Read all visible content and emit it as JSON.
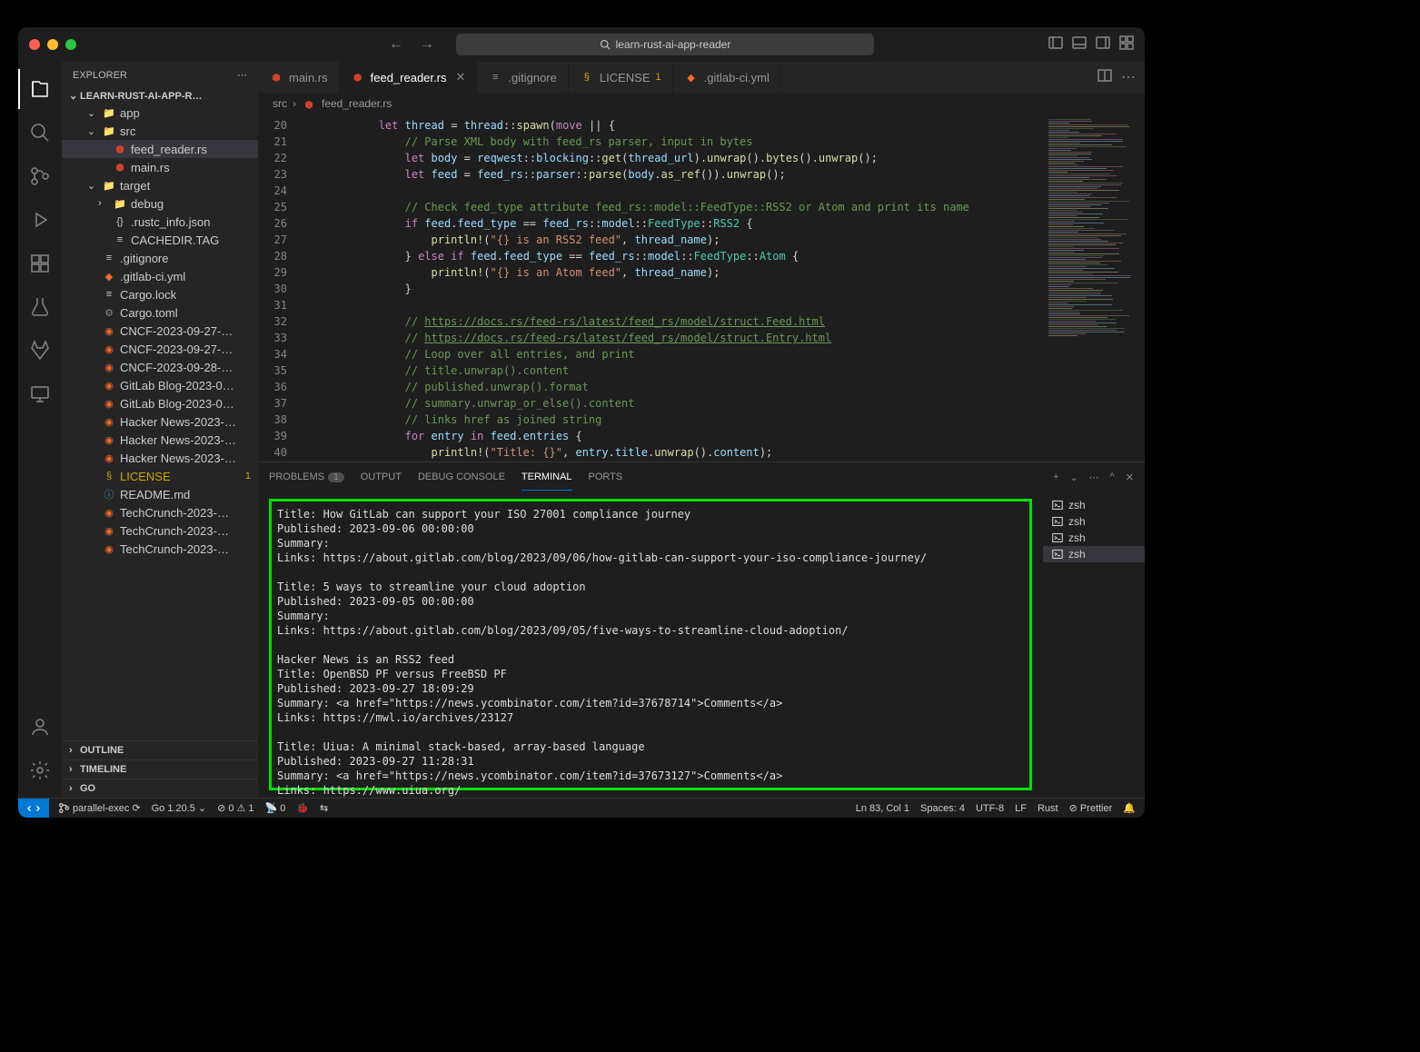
{
  "titlebar": {
    "search": "learn-rust-ai-app-reader"
  },
  "sidebar": {
    "title": "EXPLORER",
    "project": "LEARN-RUST-AI-APP-R…",
    "tree": [
      {
        "label": "app",
        "kind": "folder",
        "depth": 1,
        "open": true
      },
      {
        "label": "src",
        "kind": "folder",
        "depth": 1,
        "open": true
      },
      {
        "label": "feed_reader.rs",
        "kind": "rust",
        "depth": 2,
        "sel": true
      },
      {
        "label": "main.rs",
        "kind": "rust",
        "depth": 2
      },
      {
        "label": "target",
        "kind": "folder",
        "depth": 1,
        "open": true
      },
      {
        "label": "debug",
        "kind": "folder",
        "depth": 2,
        "open": false
      },
      {
        "label": ".rustc_info.json",
        "kind": "json",
        "depth": 2
      },
      {
        "label": "CACHEDIR.TAG",
        "kind": "file",
        "depth": 2
      },
      {
        "label": ".gitignore",
        "kind": "file",
        "depth": 1
      },
      {
        "label": ".gitlab-ci.yml",
        "kind": "gitlab",
        "depth": 1
      },
      {
        "label": "Cargo.lock",
        "kind": "file",
        "depth": 1
      },
      {
        "label": "Cargo.toml",
        "kind": "toml",
        "depth": 1
      },
      {
        "label": "CNCF-2023-09-27-…",
        "kind": "rss",
        "depth": 1
      },
      {
        "label": "CNCF-2023-09-27-…",
        "kind": "rss",
        "depth": 1
      },
      {
        "label": "CNCF-2023-09-28-…",
        "kind": "rss",
        "depth": 1
      },
      {
        "label": "GitLab Blog-2023-0…",
        "kind": "rss",
        "depth": 1
      },
      {
        "label": "GitLab Blog-2023-0…",
        "kind": "rss",
        "depth": 1
      },
      {
        "label": "Hacker News-2023-…",
        "kind": "rss",
        "depth": 1
      },
      {
        "label": "Hacker News-2023-…",
        "kind": "rss",
        "depth": 1
      },
      {
        "label": "Hacker News-2023-…",
        "kind": "rss",
        "depth": 1
      },
      {
        "label": "LICENSE",
        "kind": "license",
        "depth": 1,
        "warn": true,
        "badge": "1"
      },
      {
        "label": "README.md",
        "kind": "md",
        "depth": 1
      },
      {
        "label": "TechCrunch-2023-…",
        "kind": "rss",
        "depth": 1
      },
      {
        "label": "TechCrunch-2023-…",
        "kind": "rss",
        "depth": 1
      },
      {
        "label": "TechCrunch-2023-…",
        "kind": "rss",
        "depth": 1
      }
    ],
    "outline": "OUTLINE",
    "timeline": "TIMELINE",
    "go": "GO"
  },
  "tabs": [
    {
      "label": "main.rs",
      "icon": "rust"
    },
    {
      "label": "feed_reader.rs",
      "icon": "rust",
      "active": true
    },
    {
      "label": ".gitignore",
      "icon": "file"
    },
    {
      "label": "LICENSE",
      "icon": "license",
      "badge": "1"
    },
    {
      "label": ".gitlab-ci.yml",
      "icon": "gitlab"
    }
  ],
  "breadcrumbs": [
    "src",
    "feed_reader.rs"
  ],
  "editor": {
    "lines_start": 20,
    "lines_end": 40,
    "rows": [
      "            <span class='kw'>let</span> <span class='var'>thread</span> <span class='op'>=</span> <span class='var'>thread</span><span class='pun'>::</span><span class='fn'>spawn</span><span class='pun'>(</span><span class='kw'>move</span> <span class='pun'>||</span> <span class='pun'>{</span>",
      "                <span class='cmt'>// Parse XML body with feed_rs parser, input in bytes</span>",
      "                <span class='kw'>let</span> <span class='var'>body</span> <span class='op'>=</span> <span class='var'>reqwest</span><span class='pun'>::</span><span class='var'>blocking</span><span class='pun'>::</span><span class='fn'>get</span><span class='pun'>(</span><span class='var'>thread_url</span><span class='pun'>)</span><span class='pun'>.</span><span class='fn'>unwrap</span><span class='pun'>()</span><span class='pun'>.</span><span class='fn'>bytes</span><span class='pun'>()</span><span class='pun'>.</span><span class='fn'>unwrap</span><span class='pun'>();</span>",
      "                <span class='kw'>let</span> <span class='var'>feed</span> <span class='op'>=</span> <span class='var'>feed_rs</span><span class='pun'>::</span><span class='var'>parser</span><span class='pun'>::</span><span class='fn'>parse</span><span class='pun'>(</span><span class='var'>body</span><span class='pun'>.</span><span class='fn'>as_ref</span><span class='pun'>())</span><span class='pun'>.</span><span class='fn'>unwrap</span><span class='pun'>();</span>",
      "",
      "                <span class='cmt'>// Check feed_type attribute feed_rs::model::FeedType::RSS2 or Atom and print its name</span>",
      "                <span class='kw'>if</span> <span class='var'>feed</span><span class='pun'>.</span><span class='var'>feed_type</span> <span class='op'>==</span> <span class='var'>feed_rs</span><span class='pun'>::</span><span class='var'>model</span><span class='pun'>::</span><span class='typ'>FeedType</span><span class='pun'>::</span><span class='typ'>RSS2</span> <span class='pun'>{</span>",
      "                    <span class='fn'>println!</span><span class='pun'>(</span><span class='str'>\"{} is an RSS2 feed\"</span><span class='pun'>,</span> <span class='var'>thread_name</span><span class='pun'>);</span>",
      "                <span class='pun'>}</span> <span class='kw'>else if</span> <span class='var'>feed</span><span class='pun'>.</span><span class='var'>feed_type</span> <span class='op'>==</span> <span class='var'>feed_rs</span><span class='pun'>::</span><span class='var'>model</span><span class='pun'>::</span><span class='typ'>FeedType</span><span class='pun'>::</span><span class='typ'>Atom</span> <span class='pun'>{</span>",
      "                    <span class='fn'>println!</span><span class='pun'>(</span><span class='str'>\"{} is an Atom feed\"</span><span class='pun'>,</span> <span class='var'>thread_name</span><span class='pun'>);</span>",
      "                <span class='pun'>}</span>",
      "",
      "                <span class='cmt'>// <span class='lnk'>https://docs.rs/feed-rs/latest/feed_rs/model/struct.Feed.html</span></span>",
      "                <span class='cmt'>// <span class='lnk'>https://docs.rs/feed-rs/latest/feed_rs/model/struct.Entry.html</span></span>",
      "                <span class='cmt'>// Loop over all entries, and print</span>",
      "                <span class='cmt'>// title.unwrap().content</span>",
      "                <span class='cmt'>// published.unwrap().format</span>",
      "                <span class='cmt'>// summary.unwrap_or_else().content</span>",
      "                <span class='cmt'>// links href as joined string</span>",
      "                <span class='kw'>for</span> <span class='var'>entry</span> <span class='kw'>in</span> <span class='var'>feed</span><span class='pun'>.</span><span class='var'>entries</span> <span class='pun'>{</span>",
      "                    <span class='fn'>println!</span><span class='pun'>(</span><span class='str'>\"Title: {}\"</span><span class='pun'>,</span> <span class='var'>entry</span><span class='pun'>.</span><span class='var'>title</span><span class='pun'>.</span><span class='fn'>unwrap</span><span class='pun'>()</span><span class='pun'>.</span><span class='var'>content</span><span class='pun'>);</span>"
    ]
  },
  "panel": {
    "tabs": {
      "problems": "PROBLEMS",
      "problems_count": "1",
      "output": "OUTPUT",
      "debug": "DEBUG CONSOLE",
      "terminal": "TERMINAL",
      "ports": "PORTS"
    },
    "terminal_output": "Title: How GitLab can support your ISO 27001 compliance journey\nPublished: 2023-09-06 00:00:00\nSummary:\nLinks: https://about.gitlab.com/blog/2023/09/06/how-gitlab-can-support-your-iso-compliance-journey/\n\nTitle: 5 ways to streamline your cloud adoption\nPublished: 2023-09-05 00:00:00\nSummary:\nLinks: https://about.gitlab.com/blog/2023/09/05/five-ways-to-streamline-cloud-adoption/\n\nHacker News is an RSS2 feed\nTitle: OpenBSD PF versus FreeBSD PF\nPublished: 2023-09-27 18:09:29\nSummary: <a href=\"https://news.ycombinator.com/item?id=37678714\">Comments</a>\nLinks: https://mwl.io/archives/23127\n\nTitle: Uiua: A minimal stack-based, array-based language\nPublished: 2023-09-27 11:28:31\nSummary: <a href=\"https://news.ycombinator.com/item?id=37673127\">Comments</a>\nLinks: https://www.uiua.org/",
    "shells": [
      "zsh",
      "zsh",
      "zsh",
      "zsh"
    ]
  },
  "status": {
    "branch": "parallel-exec",
    "go": "Go 1.20.5",
    "errors": "0",
    "warnings": "1",
    "radio": "0",
    "cursor": "Ln 83, Col 1",
    "spaces": "Spaces: 4",
    "encoding": "UTF-8",
    "eol": "LF",
    "lang": "Rust",
    "prettier": "Prettier"
  }
}
